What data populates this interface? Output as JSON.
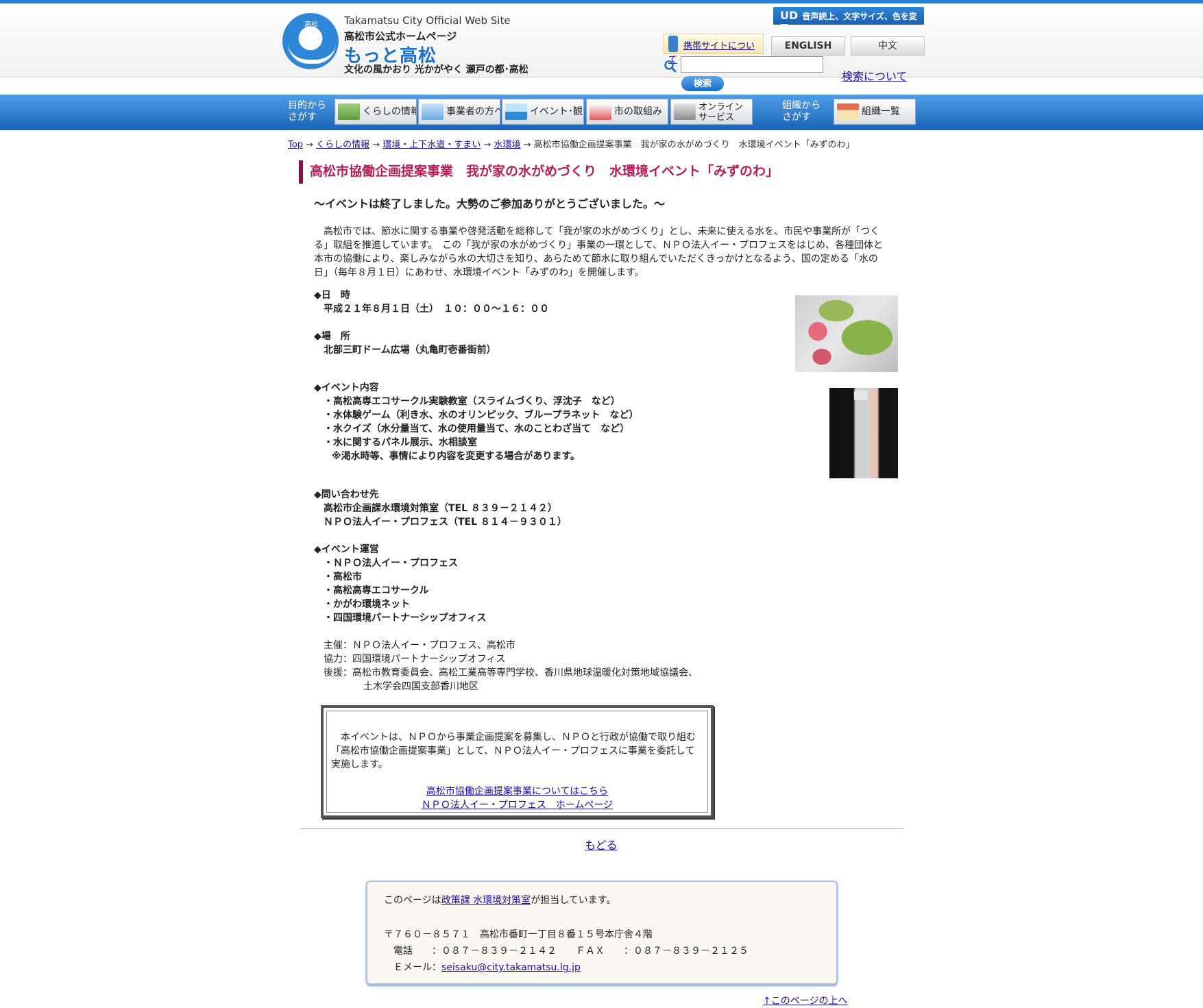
{
  "header": {
    "logo_text": "高松",
    "site_name_en": "Takamatsu City Official Web Site",
    "site_name_ja": "高松市公式ホームページ",
    "motto": "もっと高松",
    "slogan": "文化の風かおり 光かがやく 瀬戸の都･高松",
    "ud_label": "UD",
    "ud_text": "音声読上、文字サイズ、色を変更",
    "mobile_link": "携帯サイトについて",
    "lang_en": "ENGLISH",
    "lang_zh": "中文",
    "search_placeholder": "",
    "search_button": "検索",
    "search_about": "検索について"
  },
  "nav": {
    "group1_label_1": "目的から",
    "group1_label_2": "さがす",
    "group2_label_1": "組織から",
    "group2_label_2": "さがす",
    "items": [
      {
        "label": "くらしの情報"
      },
      {
        "label": "事業者の方へ"
      },
      {
        "label": "イベント･観光"
      },
      {
        "label": "市の取組み"
      },
      {
        "label_1": "オンライン",
        "label_2": "サービス"
      },
      {
        "label": "組織一覧"
      }
    ]
  },
  "breadcrumb": {
    "top": "Top",
    "l1": "くらしの情報",
    "l2": "環境・上下水道・すまい",
    "l3": "水環境",
    "current": "高松市協働企画提案事業　我が家の水がめづくり　水環境イベント「みずのわ」",
    "sep": " → "
  },
  "page": {
    "title": "高松市協働企画提案事業　我が家の水がめづくり　水環境イベント「みずのわ」",
    "subtitle": "～イベントは終了しました。大勢のご参加ありがとうございました。～",
    "intro": "　高松市では、節水に関する事業や啓発活動を総称して「我が家の水がめづくり」とし、未来に使える水を、市民や事業所が「つくる」取組を推進しています。　この「我が家の水がめづくり」事業の一環として、ＮＰＯ法人イー・プロフェスをはじめ、各種団体と本市の協働により、楽しみながら水の大切さを知り、あらためて節水に取り組んでいただくきっかけとなるよう、国の定める「水の日」（毎年８月１日）にあわせ、水環境イベント「みずのわ」を開催します。",
    "datetime_head": "◆日　時",
    "datetime": "平成２１年８月１日（土）　１０：００～１６：００",
    "place_head": "◆場　所",
    "place": "北部三町ドーム広場（丸亀町壱番街前）",
    "contents_head": "◆イベント内容",
    "contents": [
      "・高松高専エコサークル実験教室（スライムづくり、浮沈子　など）",
      "・水体験ゲーム（利き水、水のオリンピック、ブループラネット　など）",
      "・水クイズ（水分量当て、水の使用量当て、水のことわざ当て　など）",
      "・水に関するパネル展示、水相談室"
    ],
    "contents_note": "※渇水時等、事情により内容を変更する場合があります。",
    "contact_head": "◆問い合わせ先",
    "contact": [
      "高松市企画課水環境対策室（TEL ８３９－２１４２）",
      "ＮＰＯ法人イー・プロフェス（TEL ８１４－９３０１）"
    ],
    "operation_head": "◆イベント運営",
    "operation": [
      "・ＮＰＯ法人イー・プロフェス",
      "・高松市",
      "・高松高専エコサークル",
      "・かがわ環境ネット",
      "・四国環境パートナーシップオフィス"
    ],
    "sponsor": "主催：ＮＰＯ法人イー・プロフェス、高松市",
    "cooperation": "協力：四国環境パートナーシップオフィス",
    "support_1": "後援：高松市教育委員会、高松工業高等専門学校、香川県地球温暖化対策地域協議会、",
    "support_2": "土木学会四国支部香川地区",
    "box_text": "　本イベントは、ＮＰＯから事業企画提案を募集し、ＮＰＯと行政が協働で取り組む「高松市協働企画提案事業」として、ＮＰＯ法人イー・プロフェスに事業を委託して実施します。",
    "box_link_1": "高松市協働企画提案事業についてはこちら",
    "box_link_2": "ＮＰＯ法人イー・プロフェス　ホームページ",
    "back": "もどる"
  },
  "contact_box": {
    "charge_pre": "このページは",
    "charge_link": "政策課 水環境対策室",
    "charge_post": "が担当しています。",
    "address": "〒７６０－８５７１　高松市番町一丁目８番１５号本庁舎４階",
    "tel": "　電話　　：０８７－８３９－２１４２　　ＦＡＸ　　：０８７－８３９－２１２５",
    "email_label": "　Ｅメール：",
    "email": "seisaku@city.takamatsu.lg.jp"
  },
  "to_top": "↑このページの上へ"
}
